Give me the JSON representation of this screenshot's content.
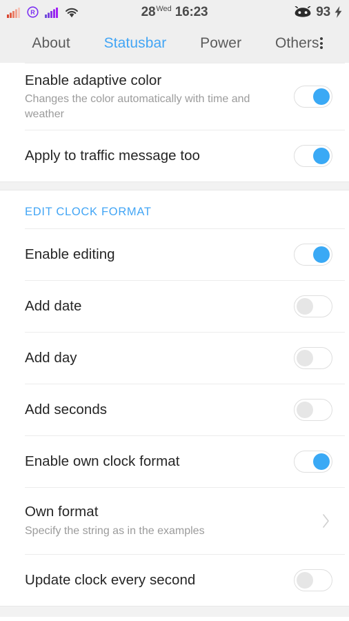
{
  "statusbar": {
    "left_icons": [
      {
        "name": "signal-bars-sim1-icon",
        "color": "#e8503a"
      },
      {
        "name": "roaming-icon",
        "color": "#7b2ff2",
        "glyph": "R"
      },
      {
        "name": "signal-bars-sim2-icon",
        "color": "#8a2be2"
      },
      {
        "name": "wifi-icon",
        "color": "#3d3d3d"
      }
    ],
    "clock": {
      "day_number": "28",
      "day_name": "Wed",
      "time": "16:23"
    },
    "battery": {
      "icon_name": "android-battery-icon",
      "level": "93",
      "charging_icon": "lightning-bolt-icon",
      "charging_glyph": "⚡"
    }
  },
  "tabs": {
    "items": [
      {
        "label": "About",
        "active": false
      },
      {
        "label": "Statusbar",
        "active": true
      },
      {
        "label": "Power",
        "active": false
      },
      {
        "label": "Others",
        "active": false
      }
    ],
    "overflow_name": "overflow-menu-icon",
    "active_color": "#42a5f5",
    "inactive_color": "#5b5b5b"
  },
  "sections": [
    {
      "rows": [
        {
          "title": "Enable adaptive color",
          "subtitle": "Changes the color automatically with time and weather",
          "control": "toggle",
          "state": "on"
        },
        {
          "title": "Apply to traffic message too",
          "subtitle": "",
          "control": "toggle",
          "state": "on"
        }
      ]
    },
    {
      "header": "EDIT CLOCK FORMAT",
      "rows": [
        {
          "title": "Enable editing",
          "subtitle": "",
          "control": "toggle",
          "state": "on"
        },
        {
          "title": "Add date",
          "subtitle": "",
          "control": "toggle",
          "state": "off"
        },
        {
          "title": "Add day",
          "subtitle": "",
          "control": "toggle",
          "state": "off"
        },
        {
          "title": "Add seconds",
          "subtitle": "",
          "control": "toggle",
          "state": "off"
        },
        {
          "title": "Enable own clock format",
          "subtitle": "",
          "control": "toggle",
          "state": "on"
        },
        {
          "title": "Own format",
          "subtitle": "Specify the string as in the examples",
          "control": "chevron",
          "state": ""
        },
        {
          "title": "Update clock every second",
          "subtitle": "",
          "control": "toggle",
          "state": "off"
        }
      ]
    }
  ],
  "colors": {
    "accent": "#42a5f5",
    "toggle_on": "#3aa9f5",
    "toggle_off": "#e6e6e6",
    "header_bg": "#efefef",
    "band_bg": "#f2f2f2"
  }
}
